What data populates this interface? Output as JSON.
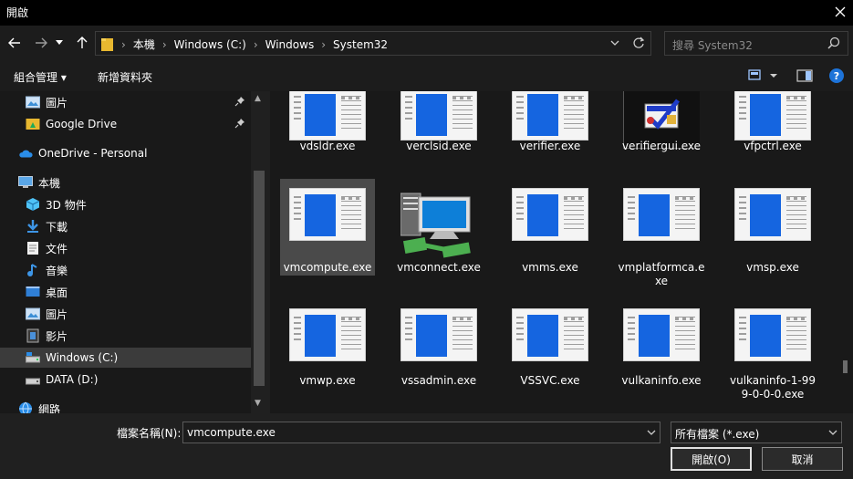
{
  "window": {
    "title": "開啟"
  },
  "nav": {
    "crumbs": [
      "本機",
      "Windows (C:)",
      "Windows",
      "System32"
    ],
    "search_placeholder": "搜尋 System32"
  },
  "toolbar": {
    "organize": "組合管理 ▾",
    "new_folder": "新增資料夾"
  },
  "sidebar": {
    "items": [
      {
        "label": "圖片",
        "icon": "pictures-icon",
        "pinned": true
      },
      {
        "label": "Google Drive",
        "icon": "google-drive-icon",
        "pinned": true
      },
      {
        "label": "OneDrive - Personal",
        "icon": "onedrive-icon"
      },
      {
        "label": "本機",
        "icon": "computer-icon"
      },
      {
        "label": "3D 物件",
        "icon": "3d-objects-icon"
      },
      {
        "label": "下載",
        "icon": "downloads-icon"
      },
      {
        "label": "文件",
        "icon": "documents-icon"
      },
      {
        "label": "音樂",
        "icon": "music-icon"
      },
      {
        "label": "桌面",
        "icon": "desktop-icon"
      },
      {
        "label": "圖片",
        "icon": "pictures-icon"
      },
      {
        "label": "影片",
        "icon": "videos-icon"
      },
      {
        "label": "Windows (C:)",
        "icon": "drive-c-icon",
        "selected": true
      },
      {
        "label": "DATA (D:)",
        "icon": "drive-d-icon"
      },
      {
        "label": "網路",
        "icon": "network-icon"
      }
    ]
  },
  "files": [
    {
      "name": "vdsldr.exe",
      "icon": "generic-exe-icon"
    },
    {
      "name": "verclsid.exe",
      "icon": "generic-exe-icon"
    },
    {
      "name": "verifier.exe",
      "icon": "generic-exe-icon"
    },
    {
      "name": "verifiergui.exe",
      "icon": "verifier-gui-icon"
    },
    {
      "name": "vfpctrl.exe",
      "icon": "generic-exe-icon"
    },
    {
      "name": "vmcompute.exe",
      "icon": "generic-exe-icon",
      "selected": true
    },
    {
      "name": "vmconnect.exe",
      "icon": "vmconnect-icon"
    },
    {
      "name": "vmms.exe",
      "icon": "generic-exe-icon"
    },
    {
      "name": "vmplatformca.e xe",
      "icon": "generic-exe-icon"
    },
    {
      "name": "vmsp.exe",
      "icon": "generic-exe-icon"
    },
    {
      "name": "vmwp.exe",
      "icon": "generic-exe-icon"
    },
    {
      "name": "vssadmin.exe",
      "icon": "generic-exe-icon"
    },
    {
      "name": "VSSVC.exe",
      "icon": "generic-exe-icon"
    },
    {
      "name": "vulkaninfo.exe",
      "icon": "generic-exe-icon"
    },
    {
      "name": "vulkaninfo-1-99 9-0-0-0.exe",
      "icon": "generic-exe-icon"
    }
  ],
  "footer": {
    "filename_label": "檔案名稱(N):",
    "filename_value": "vmcompute.exe",
    "filetype_value": "所有檔案 (*.exe)",
    "open_label": "開啟(O)",
    "cancel_label": "取消"
  },
  "colors": {
    "accent": "#1565e0",
    "background": "#191919",
    "selection": "#3b3b3b"
  }
}
